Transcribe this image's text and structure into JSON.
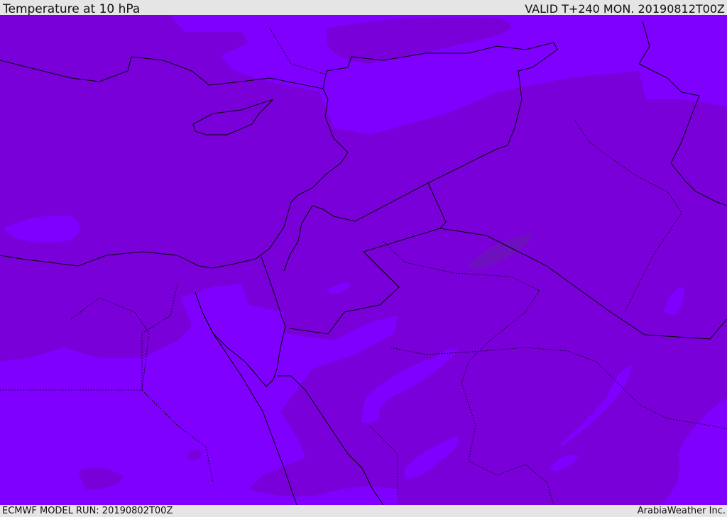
{
  "header": {
    "title": "Temperature at 10 hPa",
    "valid_time": "VALID T+240 MON. 20190812T00Z"
  },
  "footer": {
    "model_run": "ECMWF MODEL RUN: 20190802T00Z",
    "credit": "ArabiaWeather Inc."
  },
  "map": {
    "field": "temperature",
    "level": "10 hPa",
    "colors": {
      "band_dark": "#7a00da",
      "band_light": "#7f00ff",
      "band_darkest": "#6f10c0",
      "coastline": "#000000"
    }
  }
}
